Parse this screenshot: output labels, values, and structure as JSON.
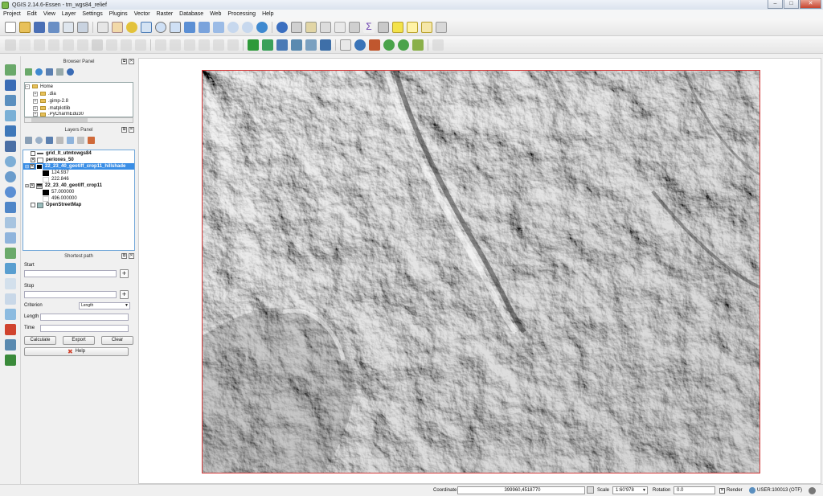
{
  "window": {
    "title": "QGIS 2.14.6-Essen - tm_wgs84_relief",
    "minimize": "–",
    "maximize": "□",
    "close": "✕"
  },
  "menu": [
    "Project",
    "Edit",
    "View",
    "Layer",
    "Settings",
    "Plugins",
    "Vector",
    "Raster",
    "Database",
    "Web",
    "Processing",
    "Help"
  ],
  "browser_panel": {
    "title": "Browser Panel",
    "items": [
      {
        "expander": "−",
        "label": "Home"
      },
      {
        "expander": "+",
        "label": ".dia"
      },
      {
        "expander": "+",
        "label": ".gimp-2.8"
      },
      {
        "expander": "+",
        "label": ".matplotlib"
      },
      {
        "expander": "+",
        "label": ".PyCharmEdu30"
      }
    ]
  },
  "layers_panel": {
    "title": "Layers Panel",
    "layers": [
      {
        "check": "",
        "name": "grid_lt_utmtowgs84"
      },
      {
        "check": "✕",
        "name": "perioxes_50"
      },
      {
        "check": "✕",
        "name": "22_23_40_geotiff_crop11_hillshade"
      },
      {
        "legend": "124.937"
      },
      {
        "legend": "222.846"
      },
      {
        "check": "✕",
        "name": "22_23_40_geotiff_crop11"
      },
      {
        "legend": "57.000000"
      },
      {
        "legend": "496.000000"
      },
      {
        "check": "",
        "name": "OpenStreetMap"
      }
    ]
  },
  "shortest_path": {
    "title": "Shortest path",
    "start_label": "Start",
    "stop_label": "Stop",
    "plus": "+",
    "criterion_label": "Criterion",
    "criterion_value": "Length",
    "length_label": "Length",
    "time_label": "Time",
    "calculate": "Calculate",
    "export": "Export",
    "clear": "Clear",
    "help": "Help"
  },
  "status": {
    "coordinate_label": "Coordinate",
    "coordinate_value": "399960,4518770",
    "scale_label": "Scale",
    "scale_value": "1:60'978",
    "rotation_label": "Rotation",
    "rotation_value": "0.0",
    "render_label": "Render",
    "crs_label": "USER:100013 (OTF)"
  },
  "colors": {
    "accent": "#3a8ee6",
    "extent_border": "#d43a3a"
  }
}
